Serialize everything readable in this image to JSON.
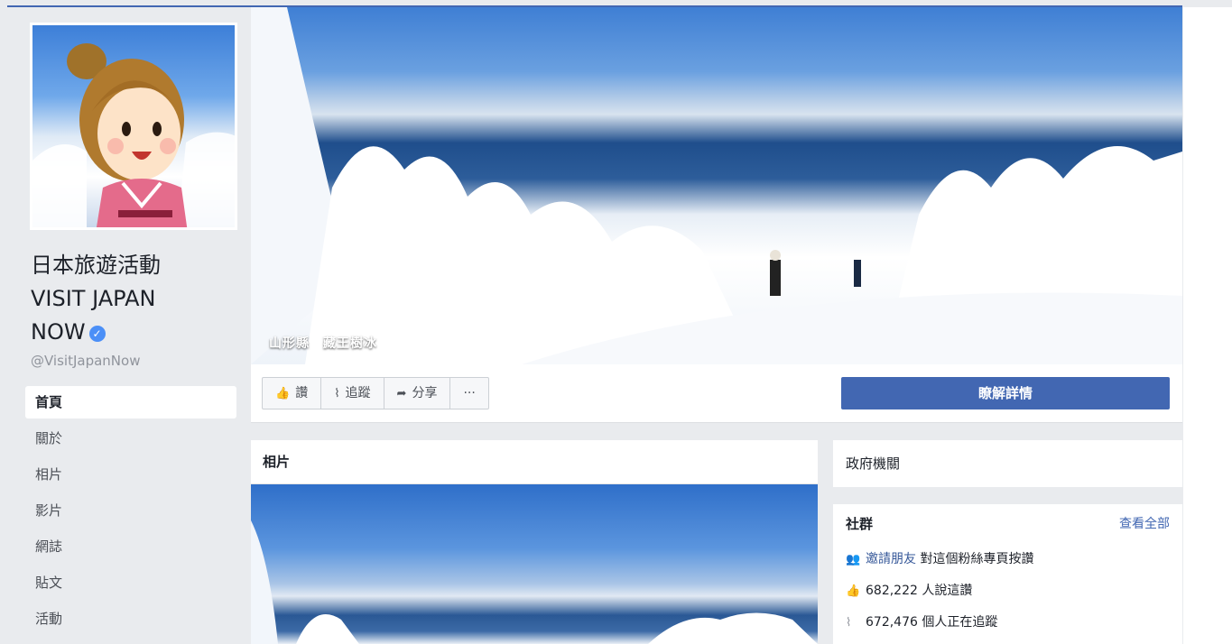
{
  "page": {
    "name_line1": "日本旅遊活動",
    "name_line2": "VISIT JAPAN",
    "name_line3": "NOW",
    "verified_icon": "check-verified-icon",
    "username": "@VisitJapanNow"
  },
  "nav": {
    "items": [
      "首頁",
      "關於",
      "相片",
      "影片",
      "網誌",
      "貼文",
      "活動"
    ],
    "active_index": 0
  },
  "cover": {
    "caption": "山形縣　藏王樹冰"
  },
  "actions": {
    "like_label": "讚",
    "like_icon": "thumbs-up-icon",
    "follow_label": "追蹤",
    "follow_icon": "rss-icon",
    "share_label": "分享",
    "share_icon": "share-arrow-icon",
    "more_label": "···",
    "cta_label": "瞭解詳情"
  },
  "photos": {
    "title": "相片"
  },
  "category": {
    "label": "政府機關"
  },
  "community": {
    "title": "社群",
    "see_all": "查看全部",
    "invite_link": "邀請朋友",
    "invite_text": "對這個粉絲專頁按讚",
    "likes_text": "682,222 人說這讚",
    "follows_text": "672,476 個人正在追蹤"
  },
  "colors": {
    "brand": "#4267b2",
    "background": "#e9ebee",
    "link": "#365899",
    "verified": "#4b8ff7"
  }
}
